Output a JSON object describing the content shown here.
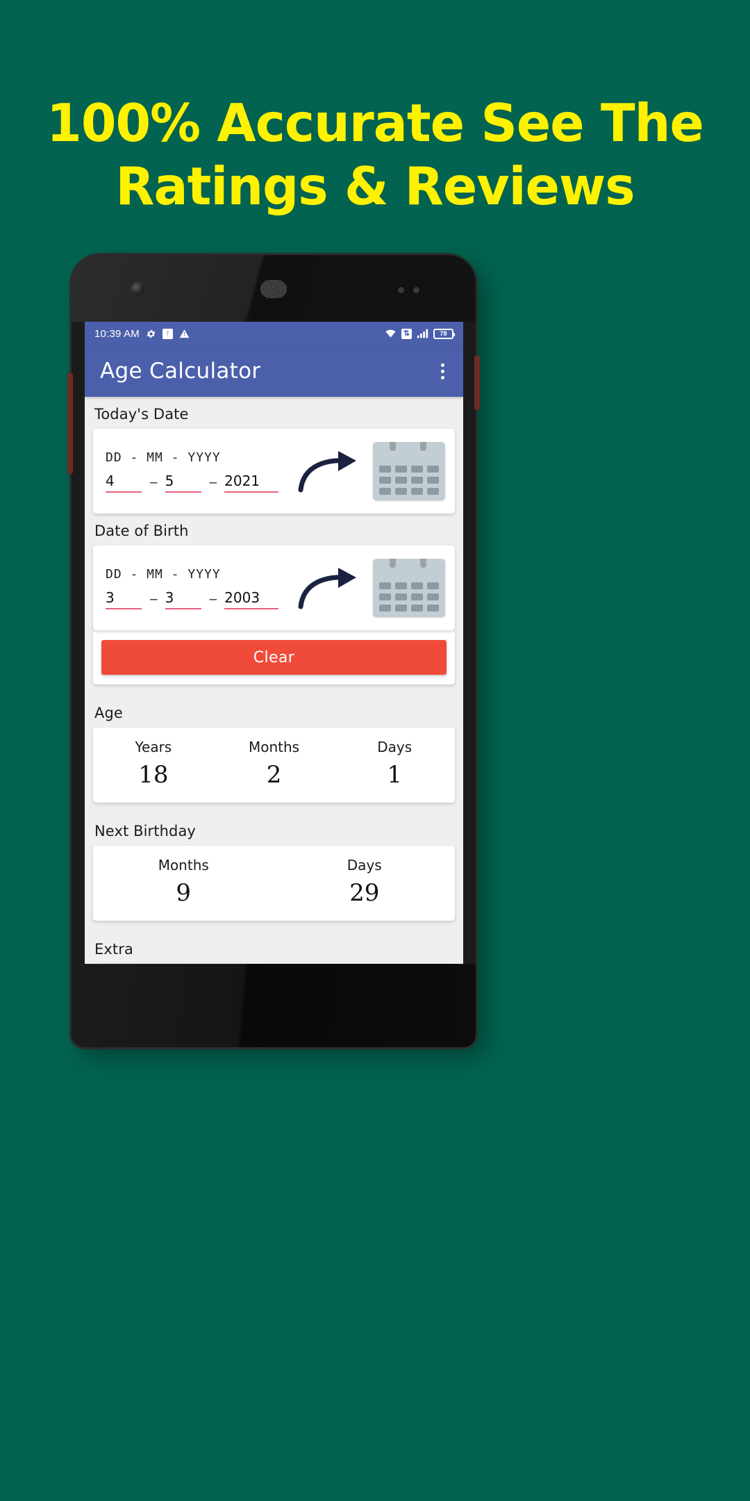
{
  "promo": {
    "headline_line1": "100% Accurate See The",
    "headline_line2": "Ratings & Reviews",
    "background_color": "#026350",
    "headline_color": "#FFF200"
  },
  "phone": {
    "statusbar": {
      "time": "10:39 AM",
      "left_icons": [
        "gear-icon",
        "upload-icon",
        "warning-icon"
      ],
      "right_icons": [
        "wifi-icon",
        "sync-icon",
        "signal-icon"
      ],
      "battery_level": "78"
    },
    "appbar": {
      "title": "Age Calculator",
      "overflow_label": "more-options",
      "color": "#4b5fab"
    },
    "sections": {
      "today": {
        "label": "Today's Date",
        "hint": "DD - MM - YYYY",
        "day": "4",
        "month": "5",
        "year": "2021",
        "separator": "–"
      },
      "dob": {
        "label": "Date of Birth",
        "hint": "DD - MM - YYYY",
        "day": "3",
        "month": "3",
        "year": "2003",
        "separator": "–"
      },
      "clear": {
        "label": "Clear",
        "color": "#f04a3a"
      },
      "age": {
        "label": "Age",
        "columns": [
          {
            "label": "Years",
            "value": "18"
          },
          {
            "label": "Months",
            "value": "2"
          },
          {
            "label": "Days",
            "value": "1"
          }
        ]
      },
      "next_birthday": {
        "label": "Next Birthday",
        "columns": [
          {
            "label": "Months",
            "value": "9"
          },
          {
            "label": "Days",
            "value": "29"
          }
        ]
      },
      "extra": {
        "label": "Extra"
      }
    }
  }
}
